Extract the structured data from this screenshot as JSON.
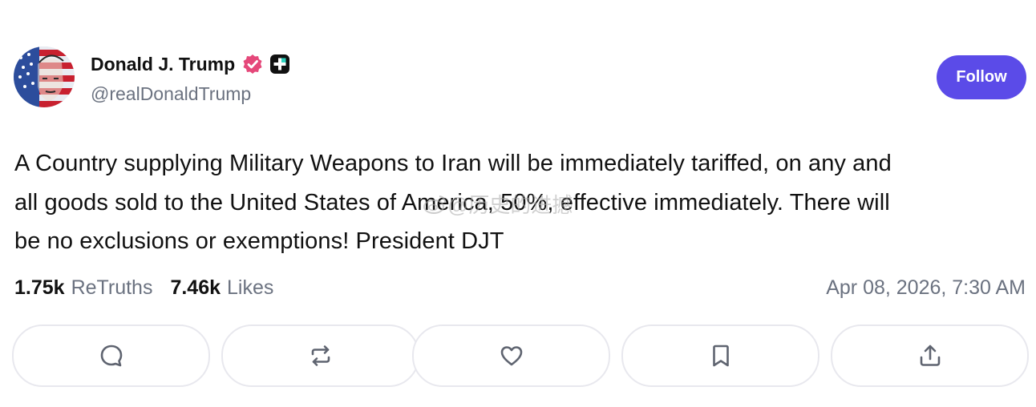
{
  "author": {
    "display_name": "Donald J. Trump",
    "handle": "@realDonaldTrump",
    "avatar_icon": "avatar-american-flag-portrait",
    "verified_icon": "verified-badge-icon",
    "plus_icon": "plus-badge-icon"
  },
  "follow_button": {
    "label": "Follow",
    "color": "#5b4be8"
  },
  "post": {
    "text": "A Country supplying Military Weapons to Iran will be immediately tariffed, on any and\nall goods sold to the United States of America, 50%, effective immediately. There will\nbe no exclusions or exemptions! President DJT"
  },
  "watermark": {
    "text": "@历史的进撼",
    "icon": "weibo-logo-icon"
  },
  "stats": {
    "retruths_count": "1.75k",
    "retruths_label": "ReTruths",
    "likes_count": "7.46k",
    "likes_label": "Likes"
  },
  "timestamp": "Apr 08, 2026, 7:30 AM",
  "actions": [
    {
      "name": "reply",
      "icon": "comment-bubble-icon"
    },
    {
      "name": "retruth",
      "icon": "repost-arrows-icon"
    },
    {
      "name": "like",
      "icon": "heart-icon"
    },
    {
      "name": "bookmark",
      "icon": "bookmark-icon"
    },
    {
      "name": "share",
      "icon": "share-upload-icon"
    }
  ],
  "colors": {
    "accent": "#5b4be8",
    "verified": "#e5487a",
    "muted_text": "#6b7280",
    "border": "#e8e8ee"
  }
}
